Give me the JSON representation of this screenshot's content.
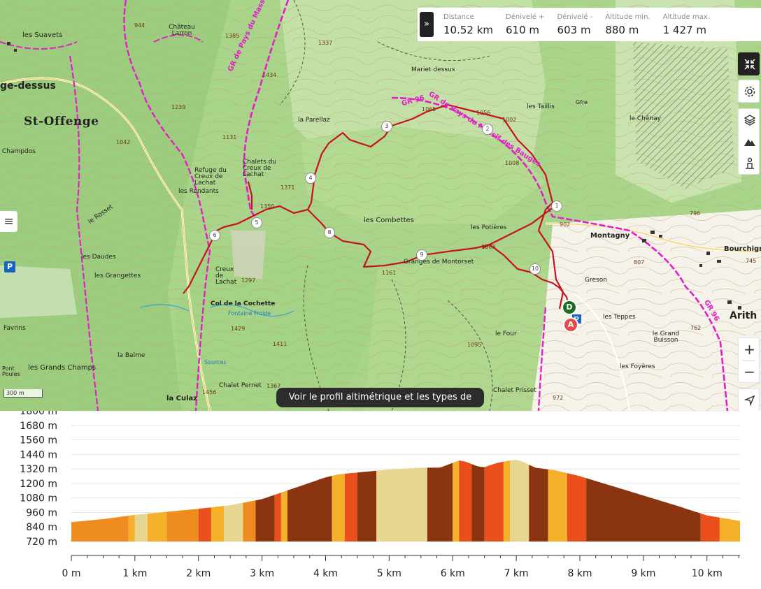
{
  "map": {
    "place_labels": [
      {
        "text": "les Suavets",
        "cls": "med"
      },
      {
        "text": "Château Larron",
        "cls": "small"
      },
      {
        "text": "ge-dessus",
        "cls": "mid"
      },
      {
        "text": "St-Offenge",
        "cls": "big"
      },
      {
        "text": "Champdos",
        "cls": "small"
      },
      {
        "text": "Refuge du Creux de Lachat",
        "cls": "small"
      },
      {
        "text": "Chalets du Creux de Lachat",
        "cls": "small"
      },
      {
        "text": "les Rendants",
        "cls": "small"
      },
      {
        "text": "le Rosset",
        "cls": "small"
      },
      {
        "text": "les Daudes",
        "cls": "small"
      },
      {
        "text": "les Grangettes",
        "cls": "small"
      },
      {
        "text": "Col de la Cochette",
        "cls": "small"
      },
      {
        "text": "Creux de Lachat",
        "cls": "small"
      },
      {
        "text": "Favrins",
        "cls": "small"
      },
      {
        "text": "les Grands Champs",
        "cls": "med"
      },
      {
        "text": "la Balme",
        "cls": "small"
      },
      {
        "text": "Pont Poules",
        "cls": "small"
      },
      {
        "text": "Chalet Pernet",
        "cls": "small"
      },
      {
        "text": "la Culaz",
        "cls": "med"
      },
      {
        "text": "Mariet dessus",
        "cls": "small"
      },
      {
        "text": "la Parellaz",
        "cls": "small"
      },
      {
        "text": "les Combettes",
        "cls": "med"
      },
      {
        "text": "les Potières",
        "cls": "small"
      },
      {
        "text": "Granges de Montorset",
        "cls": "small"
      },
      {
        "text": "le Four",
        "cls": "small"
      },
      {
        "text": "Chalet Prisset",
        "cls": "small"
      },
      {
        "text": "les Taillis",
        "cls": "small"
      },
      {
        "text": "le Chênay",
        "cls": "small"
      },
      {
        "text": "Montagny",
        "cls": "med"
      },
      {
        "text": "Bourchign",
        "cls": "med"
      },
      {
        "text": "Greson",
        "cls": "small"
      },
      {
        "text": "les Teppes",
        "cls": "small"
      },
      {
        "text": "le Grand Buisson",
        "cls": "small"
      },
      {
        "text": "les Foyères",
        "cls": "small"
      },
      {
        "text": "Arith",
        "cls": "mid"
      },
      {
        "text": "Fontaine Froide",
        "cls": "small"
      },
      {
        "text": "Sources",
        "cls": "small"
      },
      {
        "text": "Gfre",
        "cls": "small"
      }
    ],
    "altitude_labels": [
      "944",
      "1385",
      "1337",
      "1434",
      "1239",
      "1042",
      "1065",
      "1056",
      "1002",
      "1008",
      "1371",
      "1350",
      "1297",
      "1063",
      "1161",
      "1429",
      "1411",
      "1367",
      "1095",
      "902",
      "796",
      "807",
      "745",
      "762",
      "972",
      "1131",
      "1456"
    ],
    "trail_labels": [
      "GR de Pays du Massif des Bauges",
      "GR 96",
      "GR de Pays du Massif des Bauges",
      "GR 96"
    ],
    "waypoints": [
      "1",
      "2",
      "3",
      "4",
      "5",
      "6",
      "8",
      "9",
      "10"
    ],
    "start_marker": "D",
    "end_marker": "A",
    "parking_label": "P",
    "scale_label": "300 m",
    "profile_button": "Voir le profil altimétrique et les types de voies",
    "menu_icon": "hamburger-icon"
  },
  "stats": [
    {
      "key": "Distance",
      "value": "10.52 km"
    },
    {
      "key": "Dénivelé +",
      "value": "610 m"
    },
    {
      "key": "Dénivelé -",
      "value": "603 m"
    },
    {
      "key": "Altitude min.",
      "value": "880 m"
    },
    {
      "key": "Altitude max.",
      "value": "1 427 m"
    }
  ],
  "toolbar": {
    "collapse_icon": "chevrons-right-icon",
    "fullscreen_icon": "compress-arrows-icon",
    "settings_icon": "gear-icon",
    "layers_icon": "layers-icon",
    "terrain_icon": "mountain-icon",
    "person_icon": "person-icon",
    "zoom_in": "+",
    "zoom_out": "−",
    "locate_icon": "navigation-arrow-icon"
  },
  "chart_data": {
    "type": "area",
    "title": "",
    "xlabel": "",
    "ylabel": "",
    "y_ticks": [
      "1800 m",
      "1680 m",
      "1560 m",
      "1440 m",
      "1320 m",
      "1200 m",
      "1080 m",
      "960 m",
      "840 m",
      "720 m"
    ],
    "x_ticks": [
      "0 m",
      "1 km",
      "2 km",
      "3 km",
      "4 km",
      "5 km",
      "6 km",
      "7 km",
      "8 km",
      "9 km",
      "10 km"
    ],
    "ylim": [
      720,
      1800
    ],
    "xlim": [
      0,
      10.52
    ],
    "x": [
      0,
      0.5,
      1.0,
      1.5,
      2.0,
      2.5,
      3.0,
      3.5,
      4.0,
      4.2,
      4.5,
      5.0,
      5.5,
      5.8,
      6.0,
      6.1,
      6.2,
      6.4,
      6.5,
      6.7,
      6.9,
      7.0,
      7.1,
      7.3,
      7.6,
      8.0,
      8.5,
      9.0,
      9.5,
      10.0,
      10.52
    ],
    "y": [
      880,
      905,
      940,
      965,
      990,
      1020,
      1070,
      1160,
      1250,
      1275,
      1290,
      1315,
      1330,
      1330,
      1370,
      1390,
      1380,
      1340,
      1335,
      1370,
      1390,
      1395,
      1380,
      1330,
      1310,
      1260,
      1180,
      1100,
      1020,
      935,
      890
    ],
    "segments": [
      {
        "to": 0.9,
        "color": "#ef8c1f"
      },
      {
        "to": 1.0,
        "color": "#f5b02a"
      },
      {
        "to": 1.2,
        "color": "#e6d68f"
      },
      {
        "to": 1.5,
        "color": "#f5b02a"
      },
      {
        "to": 2.0,
        "color": "#ef8c1f"
      },
      {
        "to": 2.2,
        "color": "#e94e1b"
      },
      {
        "to": 2.4,
        "color": "#f5b02a"
      },
      {
        "to": 2.7,
        "color": "#e6d68f"
      },
      {
        "to": 2.9,
        "color": "#ef8c1f"
      },
      {
        "to": 3.2,
        "color": "#8b3510"
      },
      {
        "to": 3.3,
        "color": "#e94e1b"
      },
      {
        "to": 3.4,
        "color": "#f5b02a"
      },
      {
        "to": 4.1,
        "color": "#8b3510"
      },
      {
        "to": 4.3,
        "color": "#f5b02a"
      },
      {
        "to": 4.5,
        "color": "#e94e1b"
      },
      {
        "to": 4.8,
        "color": "#8b3510"
      },
      {
        "to": 5.6,
        "color": "#e6d68f"
      },
      {
        "to": 6.0,
        "color": "#8b3510"
      },
      {
        "to": 6.1,
        "color": "#f5b02a"
      },
      {
        "to": 6.3,
        "color": "#e94e1b"
      },
      {
        "to": 6.5,
        "color": "#8b3510"
      },
      {
        "to": 6.8,
        "color": "#e94e1b"
      },
      {
        "to": 6.9,
        "color": "#f5b02a"
      },
      {
        "to": 7.2,
        "color": "#e6d68f"
      },
      {
        "to": 7.5,
        "color": "#8b3510"
      },
      {
        "to": 7.8,
        "color": "#f5b02a"
      },
      {
        "to": 8.1,
        "color": "#e94e1b"
      },
      {
        "to": 9.9,
        "color": "#8b3510"
      },
      {
        "to": 10.2,
        "color": "#e94e1b"
      },
      {
        "to": 10.52,
        "color": "#f5b02a"
      }
    ]
  }
}
